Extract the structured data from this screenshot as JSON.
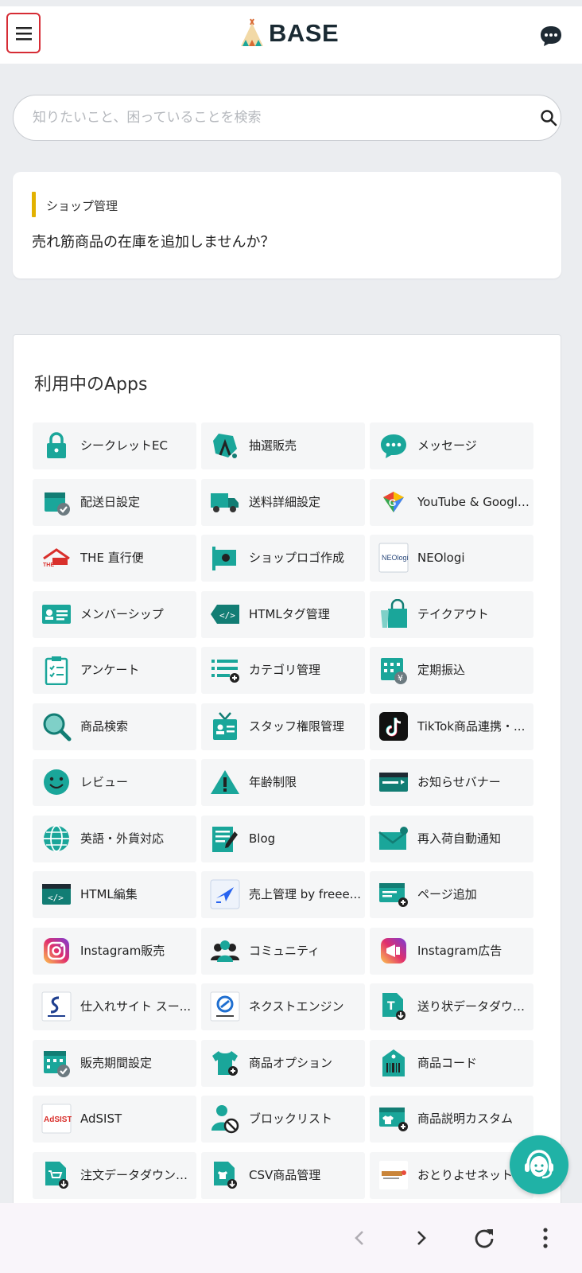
{
  "header": {
    "logo_text": "BASE"
  },
  "search": {
    "placeholder": "知りたいこと、困っていることを検索"
  },
  "notice": {
    "category": "ショップ管理",
    "text": "売れ筋商品の在庫を追加しませんか？"
  },
  "apps": {
    "title": "利用中のApps",
    "items": [
      {
        "label": "シークレットEC",
        "icon": "lock-icon"
      },
      {
        "label": "抽選販売",
        "icon": "lottery-icon"
      },
      {
        "label": "メッセージ",
        "icon": "message-icon"
      },
      {
        "label": "配送日設定",
        "icon": "delivery-date-icon"
      },
      {
        "label": "送料詳細設定",
        "icon": "truck-icon"
      },
      {
        "label": "YouTube & Google...",
        "icon": "google-icon"
      },
      {
        "label": "THE 直行便",
        "icon": "the-chokkoubin-icon"
      },
      {
        "label": "ショップロゴ作成",
        "icon": "shop-logo-icon"
      },
      {
        "label": "NEOlogi",
        "icon": "neologi-icon"
      },
      {
        "label": "メンバーシップ",
        "icon": "membership-card-icon"
      },
      {
        "label": "HTMLタグ管理",
        "icon": "html-tag-icon"
      },
      {
        "label": "テイクアウト",
        "icon": "takeout-icon"
      },
      {
        "label": "アンケート",
        "icon": "clipboard-icon"
      },
      {
        "label": "カテゴリ管理",
        "icon": "category-list-icon"
      },
      {
        "label": "定期振込",
        "icon": "calendar-yen-icon"
      },
      {
        "label": "商品検索",
        "icon": "magnifier-icon"
      },
      {
        "label": "スタッフ権限管理",
        "icon": "staff-badge-icon"
      },
      {
        "label": "TikTok商品連携・...",
        "icon": "tiktok-icon"
      },
      {
        "label": "レビュー",
        "icon": "smile-icon"
      },
      {
        "label": "年齢制限",
        "icon": "warning-icon"
      },
      {
        "label": "お知らせバナー",
        "icon": "banner-icon"
      },
      {
        "label": "英語・外貨対応",
        "icon": "globe-icon"
      },
      {
        "label": "Blog",
        "icon": "blog-icon"
      },
      {
        "label": "再入荷自動通知",
        "icon": "mail-notify-icon"
      },
      {
        "label": "HTML編集",
        "icon": "html-edit-icon"
      },
      {
        "label": "売上管理 by freee...",
        "icon": "freee-icon"
      },
      {
        "label": "ページ追加",
        "icon": "page-add-icon"
      },
      {
        "label": "Instagram販売",
        "icon": "instagram-icon"
      },
      {
        "label": "コミュニティ",
        "icon": "community-icon"
      },
      {
        "label": "Instagram広告",
        "icon": "instagram-ads-icon"
      },
      {
        "label": "仕入れサイト スー...",
        "icon": "supplier-icon"
      },
      {
        "label": "ネクストエンジン",
        "icon": "next-engine-icon"
      },
      {
        "label": "送り状データダウン...",
        "icon": "invoice-download-icon"
      },
      {
        "label": "販売期間設定",
        "icon": "sales-period-icon"
      },
      {
        "label": "商品オプション",
        "icon": "tshirt-plus-icon"
      },
      {
        "label": "商品コード",
        "icon": "barcode-tag-icon"
      },
      {
        "label": "AdSIST",
        "icon": "adsist-icon"
      },
      {
        "label": "ブロックリスト",
        "icon": "block-user-icon"
      },
      {
        "label": "商品説明カスタム",
        "icon": "description-custom-icon"
      },
      {
        "label": "注文データダウンロ...",
        "icon": "order-download-icon"
      },
      {
        "label": "CSV商品管理",
        "icon": "csv-icon"
      },
      {
        "label": "おとりよせネット",
        "icon": "otoriyose-icon"
      }
    ]
  },
  "colors": {
    "teal": "#1aa69a",
    "dark_teal": "#127d74",
    "accent_yellow": "#e2b100",
    "menu_border": "#d62c35"
  }
}
